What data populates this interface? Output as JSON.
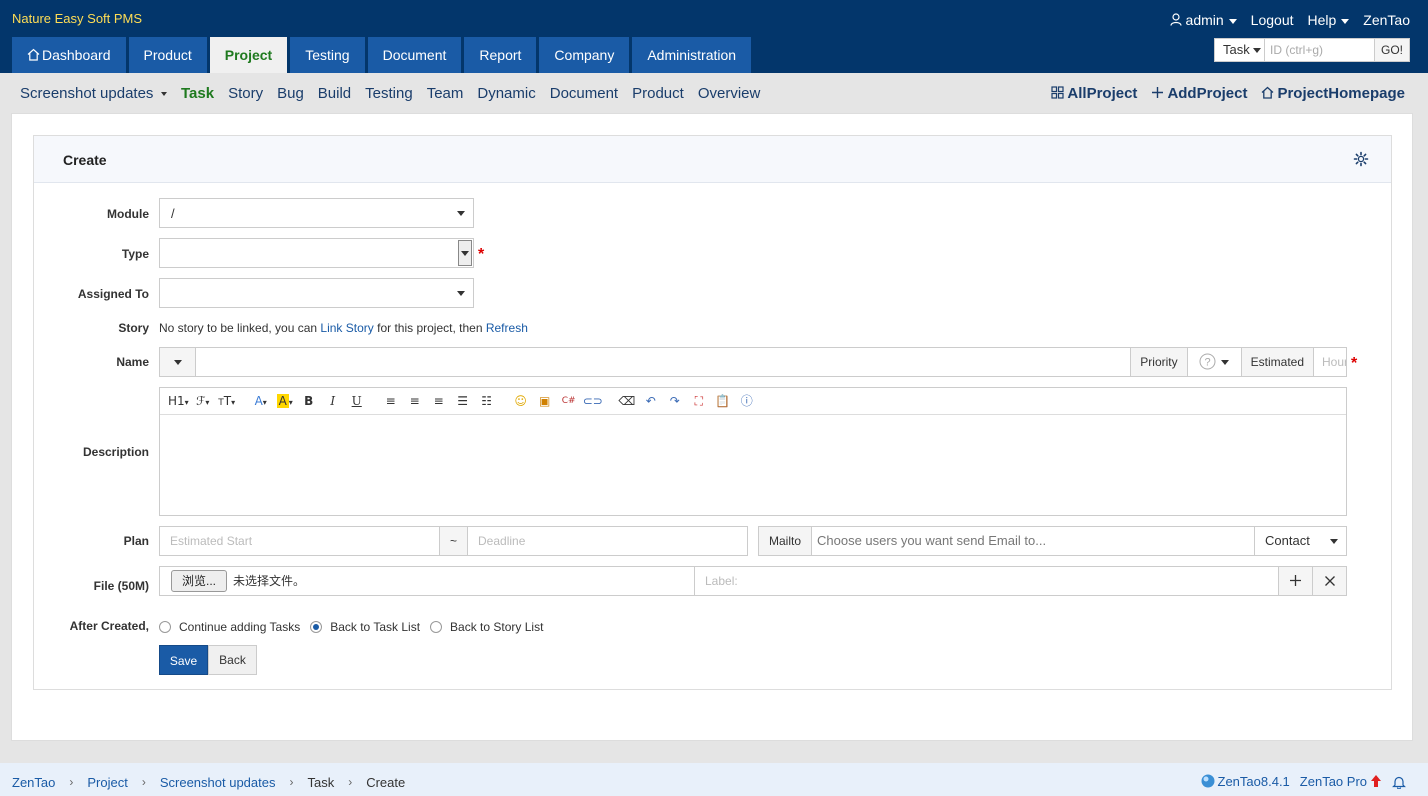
{
  "header": {
    "app_title": "Nature Easy Soft PMS",
    "user": "admin",
    "logout": "Logout",
    "help": "Help",
    "brand": "ZenTao",
    "search_type": "Task",
    "search_placeholder": "ID (ctrl+g)",
    "search_go": "GO!"
  },
  "mainnav": {
    "tabs": [
      {
        "label": "Dashboard"
      },
      {
        "label": "Product"
      },
      {
        "label": "Project",
        "active": true
      },
      {
        "label": "Testing"
      },
      {
        "label": "Document"
      },
      {
        "label": "Report"
      },
      {
        "label": "Company"
      },
      {
        "label": "Administration"
      }
    ]
  },
  "subnav": {
    "project": "Screenshot updates",
    "links": [
      "Task",
      "Story",
      "Bug",
      "Build",
      "Testing",
      "Team",
      "Dynamic",
      "Document",
      "Product",
      "Overview"
    ],
    "active_link": "Task",
    "all_project": "AllProject",
    "add_project": "AddProject",
    "project_homepage": "ProjectHomepage"
  },
  "form": {
    "title": "Create",
    "module_label": "Module",
    "module_value": "/",
    "type_label": "Type",
    "type_value": "",
    "assigned_label": "Assigned To",
    "assigned_value": "",
    "story_label": "Story",
    "story_text_1": "No story to be linked, you can ",
    "story_link": "Link Story",
    "story_text_2": " for this project, then ",
    "story_refresh": "Refresh",
    "name_label": "Name",
    "priority_label": "Priority",
    "estimated_label": "Estimated",
    "hours_placeholder": "Hours",
    "description_label": "Description",
    "plan_label": "Plan",
    "est_start_placeholder": "Estimated Start",
    "tilde": "~",
    "deadline_placeholder": "Deadline",
    "mailto_label": "Mailto",
    "mailto_placeholder": "Choose users you want send Email to...",
    "contact_label": "Contact",
    "file_label": "File (50M)",
    "browse_label": "浏览...",
    "no_file_text": "未选择文件。",
    "file_label_placeholder": "Label:",
    "after_created_label": "After Created,",
    "after_options": [
      {
        "label": "Continue adding Tasks",
        "checked": false
      },
      {
        "label": "Back to Task List",
        "checked": true
      },
      {
        "label": "Back to Story List",
        "checked": false
      }
    ],
    "save_label": "Save",
    "back_label": "Back"
  },
  "toolbar": [
    "H1",
    "F",
    "TT",
    "A",
    "A",
    "B",
    "I",
    "U",
    "align-left",
    "align-center",
    "align-right",
    "ordered-list",
    "unordered-list",
    "emoticon",
    "image",
    "code",
    "link",
    "eraser",
    "undo",
    "redo",
    "fullscreen",
    "paste",
    "help"
  ],
  "footer": {
    "crumbs": [
      "ZenTao",
      "Screenshot updates",
      "Project",
      "Task",
      "Create"
    ],
    "crumb_zentao": "ZenTao",
    "crumb_project": "Project",
    "crumb_screenshot": "Screenshot updates",
    "crumb_task": "Task",
    "crumb_create": "Create",
    "version": "ZenTao8.4.1",
    "pro": "ZenTao Pro"
  },
  "colors": {
    "header_bg": "#03366b",
    "tab_bg": "#1a5ba6",
    "active_green": "#1f7a1f",
    "title_yellow": "#ffdd55",
    "required_red": "#dd0000"
  }
}
